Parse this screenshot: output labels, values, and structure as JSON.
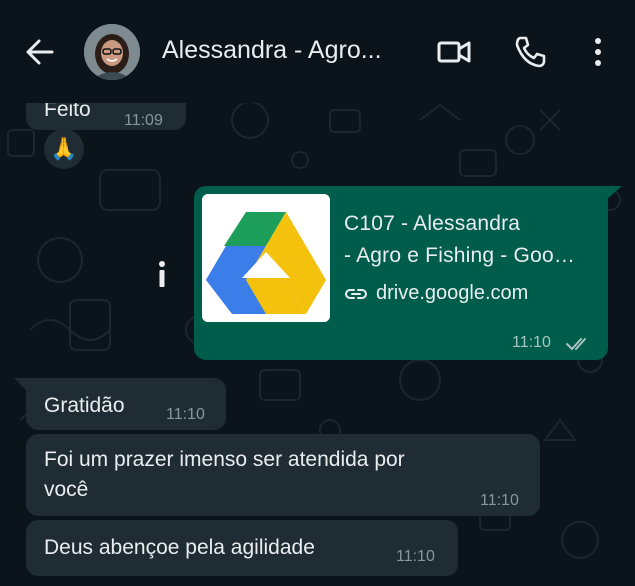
{
  "header": {
    "title": "Alessandra - Agro...",
    "back_icon": "arrow-left-icon",
    "video_icon": "video-call-icon",
    "call_icon": "phone-icon",
    "menu_icon": "more-vertical-icon"
  },
  "messages": [
    {
      "text": "Feito",
      "time": "11:09",
      "direction": "in",
      "reaction": "🙏"
    },
    {
      "direction": "out",
      "link": {
        "title_line1": "C107 - Alessandra",
        "title_line2": "- Agro e Fishing - Goo…",
        "domain": "drive.google.com",
        "thumbnail_icon": "google-drive-icon"
      },
      "time": "11:10",
      "status": "read-double-check"
    },
    {
      "text": "Gratidão",
      "time": "11:10",
      "direction": "in"
    },
    {
      "text_line1": "Foi um prazer imenso ser atendida por",
      "text_line2": "você",
      "time": "11:10",
      "direction": "in"
    },
    {
      "text": "Deus abençoe pela agilidade",
      "time": "11:10",
      "direction": "in"
    }
  ],
  "info_button_icon": "info-icon",
  "colors": {
    "background": "#0b141a",
    "incoming_bubble": "#202c33",
    "outgoing_bubble": "#005c4b",
    "muted": "#8696a0"
  }
}
